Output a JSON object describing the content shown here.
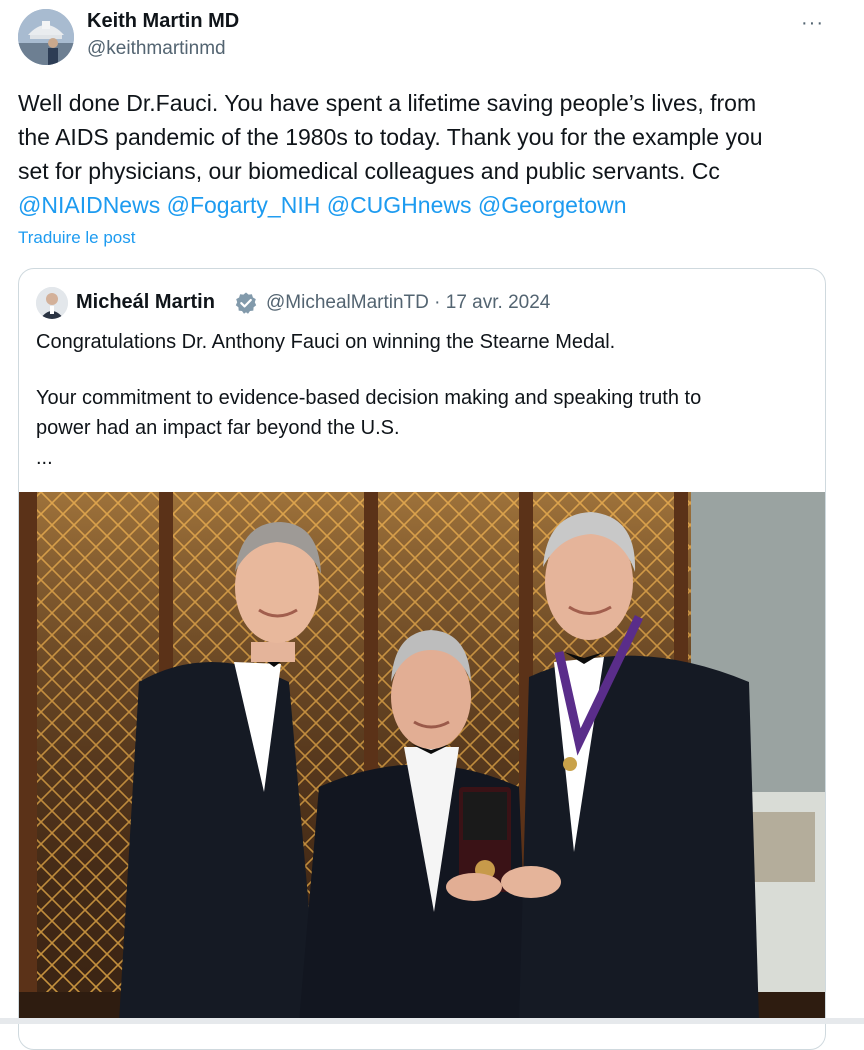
{
  "tweet": {
    "author_name": "Keith Martin MD",
    "author_handle": "@keithmartinmd",
    "more_label": "···",
    "text_lines": [
      "Well done Dr.Fauci.  You have spent a lifetime saving people’s lives,  from",
      "the AIDS pandemic of the 1980s to today. Thank you for the example you",
      "set for physicians, our biomedical colleagues and public servants. Cc"
    ],
    "mentions": [
      "@NIAIDNews",
      "@Fogarty_NIH",
      "@CUGHnews",
      "@Georgetown"
    ],
    "translate_label": "Traduire le post"
  },
  "quoted": {
    "author_name": "Micheál Martin",
    "author_handle_date": "@MichealMartinTD · 17 avr. 2024",
    "line1": "Congratulations Dr. Anthony Fauci on winning the Stearne Medal.",
    "line2a": "Your commitment to evidence-based decision making and speaking truth to",
    "line2b": "power had an impact far beyond the U.S.",
    "ellipsis": "...",
    "verified_color": "#829aab"
  },
  "colors": {
    "link": "#1d9bf0",
    "secondary_text": "#536471",
    "border": "#cfd9de"
  }
}
